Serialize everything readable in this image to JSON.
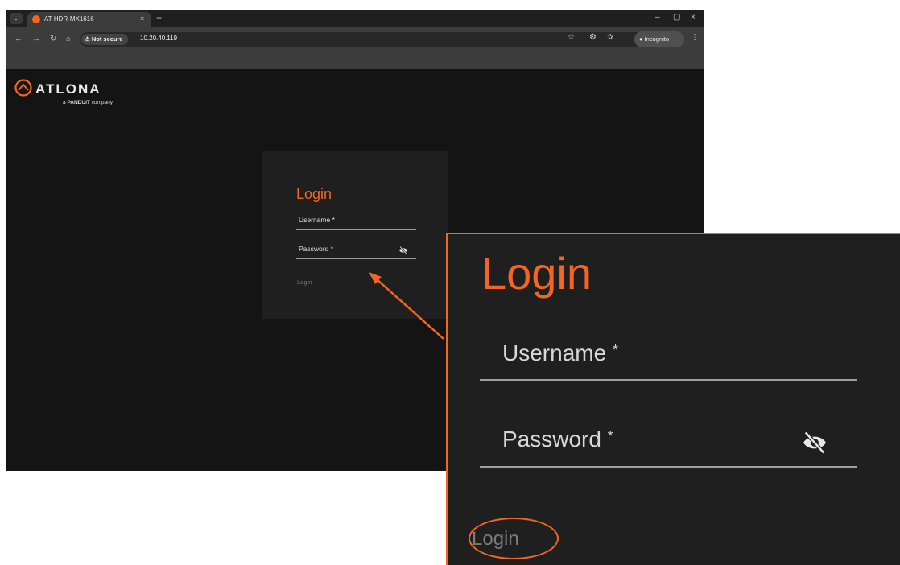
{
  "browser": {
    "tab_title": "AT-HDR-MX1616",
    "tab_close": "×",
    "new_tab": "+",
    "minimize": "–",
    "maximize": "▢",
    "close": "×",
    "security_label": "Not secure",
    "url": "10.20.40.119",
    "incognito_label": "Incognito"
  },
  "branding": {
    "logo_text": "ATLONA",
    "logo_sub_prefix": "a",
    "logo_sub_brand": "PANDUIT",
    "logo_sub_suffix": "company"
  },
  "login": {
    "title": "Login",
    "username_label": "Username *",
    "password_label": "Password *",
    "submit_label": "Login"
  },
  "zoom": {
    "title": "Login",
    "username_label": "Username",
    "password_label": "Password",
    "required_mark": "*",
    "submit_label": "Login"
  },
  "colors": {
    "accent": "#f26522",
    "page_bg": "#141414",
    "card_bg": "#1f1f1f"
  },
  "icons": [
    "chevron-down-icon",
    "atlona-favicon-icon",
    "back-icon",
    "forward-icon",
    "reload-icon",
    "home-icon",
    "warning-icon",
    "star-icon",
    "extensions-icon",
    "bookmarks-icon",
    "incognito-icon",
    "more-icon",
    "eye-off-icon"
  ]
}
